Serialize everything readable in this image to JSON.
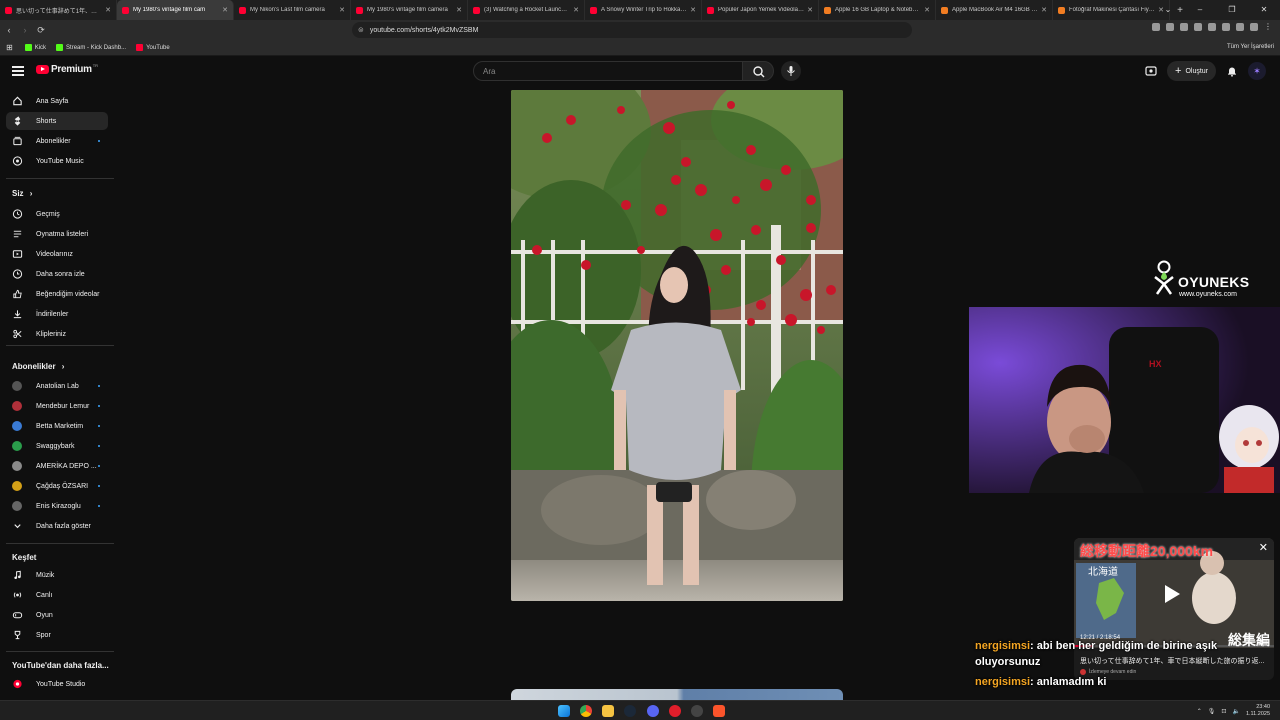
{
  "browser": {
    "tabs": [
      {
        "title": "思い切って仕事辞めて1年、車で日本",
        "active": false,
        "fav": "red"
      },
      {
        "title": "My 1980's vintage film cam",
        "active": true,
        "fav": "red"
      },
      {
        "title": "My Nikon's Last film camera",
        "active": false,
        "fav": "red"
      },
      {
        "title": "My 1980's vintage film camera",
        "active": false,
        "fav": "red"
      },
      {
        "title": "(3) Watching a Rocket Launch at S",
        "active": false,
        "fav": "red"
      },
      {
        "title": "A Snowy Winter Trip to Hokkaido |",
        "active": false,
        "fav": "red"
      },
      {
        "title": "Popüler Japon Yemek Videoları To",
        "active": false,
        "fav": "red"
      },
      {
        "title": "Apple 16 GB Laptop & Notebook",
        "active": false,
        "fav": "orange"
      },
      {
        "title": "Apple MacBook Air M4 16GB 256",
        "active": false,
        "fav": "orange"
      },
      {
        "title": "Fotoğraf Makinesi Çantası Fiyatları",
        "active": false,
        "fav": "orange"
      }
    ],
    "new_tab": "+",
    "window_controls": [
      "⌄",
      "–",
      "❐",
      "✕"
    ],
    "url": "youtube.com/shorts/4ytk2MvZSBM",
    "bookmarks": [
      {
        "label": "Kick",
        "color": "#53fc18"
      },
      {
        "label": "Stream - Kick Dashb...",
        "color": "#53fc18"
      },
      {
        "label": "YouTube",
        "color": "#ff0033"
      }
    ],
    "bookmarks_right": "Tüm Yer İşaretleri"
  },
  "header": {
    "brand": "Premium",
    "country": "TR",
    "search_placeholder": "Ara",
    "create_label": "Oluştur"
  },
  "sidebar": {
    "main": [
      {
        "label": "Ana Sayfa",
        "icon": "home-icon"
      },
      {
        "label": "Shorts",
        "icon": "shorts-icon",
        "active": true
      },
      {
        "label": "Abonelikler",
        "icon": "subscriptions-icon",
        "dot": true
      },
      {
        "label": "YouTube Music",
        "icon": "music-icon"
      }
    ],
    "you_heading": "Siz",
    "you": [
      {
        "label": "Geçmiş",
        "icon": "history-icon"
      },
      {
        "label": "Oynatma listeleri",
        "icon": "playlists-icon"
      },
      {
        "label": "Videolarınız",
        "icon": "your-videos-icon"
      },
      {
        "label": "Daha sonra izle",
        "icon": "watch-later-icon"
      },
      {
        "label": "Beğendiğim videolar",
        "icon": "liked-icon"
      },
      {
        "label": "İndirilenler",
        "icon": "downloads-icon"
      },
      {
        "label": "Klipleriniz",
        "icon": "clips-icon"
      }
    ],
    "subs_heading": "Abonelikler",
    "subs": [
      {
        "label": "Anatolian Lab",
        "color": "#555555"
      },
      {
        "label": "Mendebur Lemur",
        "color": "#b0303a"
      },
      {
        "label": "Betta Marketim",
        "color": "#3a7bd5"
      },
      {
        "label": "Swaggybark",
        "color": "#2a9d4b"
      },
      {
        "label": "AMERİKA DEPO ...",
        "color": "#8a8a8a"
      },
      {
        "label": "Çağdaş ÖZSARI",
        "color": "#d4a017"
      },
      {
        "label": "Enis Kirazoglu",
        "color": "#666666"
      }
    ],
    "show_more": "Daha fazla göster",
    "explore_heading": "Keşfet",
    "explore": [
      {
        "label": "Müzik",
        "icon": "music-note-icon"
      },
      {
        "label": "Canlı",
        "icon": "live-icon"
      },
      {
        "label": "Oyun",
        "icon": "gaming-icon"
      },
      {
        "label": "Spor",
        "icon": "trophy-icon"
      }
    ],
    "more_heading": "YouTube'dan daha fazla...",
    "studio": "YouTube Studio"
  },
  "overlay": {
    "brand_name": "OYUNEKS",
    "brand_url": "www.oyuneks.com",
    "pip_title": "思い切って仕事辞めて1年、車で日本縦断した旅の振り返...",
    "pip_banner": "総移動距離20,000km",
    "pip_region": "北海道",
    "pip_time": "12:21 / 2:18:54",
    "pip_sub": "İzlemeye devam edin",
    "pip_overlay_text": "総集編",
    "chat": [
      {
        "user": "nergisimsi",
        "message": ": abi ben her geldiğim de birine aşık oluyorsunuz"
      },
      {
        "user": "nergisimsi",
        "message": ": anlamadım ki"
      }
    ]
  },
  "taskbar": {
    "time": "23:40",
    "date": "1.11.2025"
  }
}
